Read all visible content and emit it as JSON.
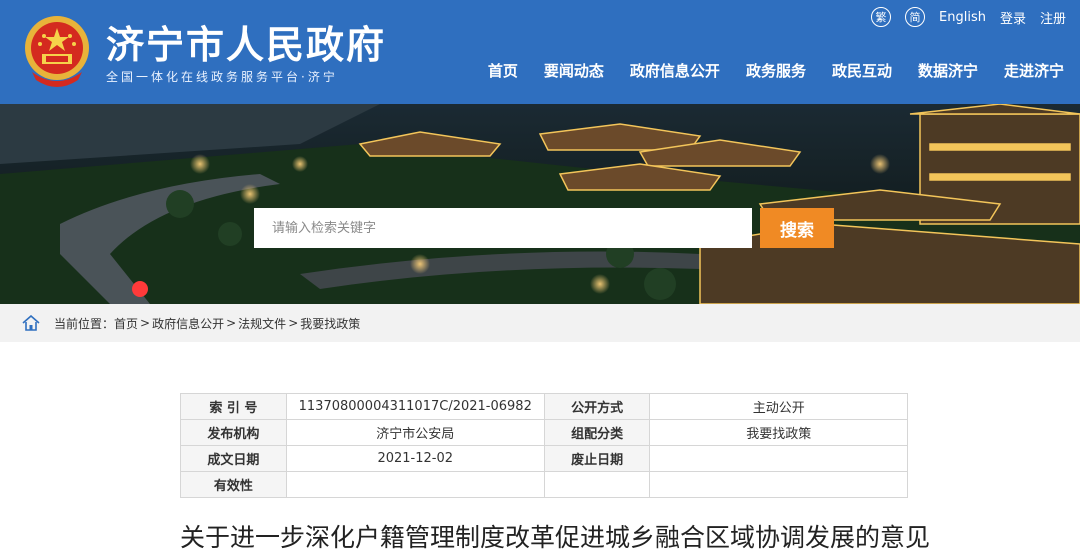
{
  "header": {
    "site_title": "济宁市人民政府",
    "site_subtitle": "全国一体化在线政务服务平台·济宁",
    "emblem_icon": "national-emblem-icon",
    "background_color": "#2f6fbf",
    "utility": {
      "traditional": "繁",
      "simplified": "简",
      "english": "English",
      "login": "登录",
      "register": "注册"
    },
    "nav": [
      {
        "label": "首页"
      },
      {
        "label": "要闻动态"
      },
      {
        "label": "政府信息公开"
      },
      {
        "label": "政务服务"
      },
      {
        "label": "政民互动"
      },
      {
        "label": "数据济宁"
      },
      {
        "label": "走进济宁"
      }
    ]
  },
  "search": {
    "placeholder": "请输入检索关键字",
    "button_label": "搜索",
    "button_color": "#f08a24"
  },
  "breadcrumb": {
    "home_icon": "home-icon",
    "prefix": "当前位置：",
    "items": [
      "首页",
      "政府信息公开",
      "法规文件",
      "我要找政策"
    ],
    "separator": ">"
  },
  "meta": {
    "rows": [
      {
        "label1": "索 引 号",
        "value1": "11370800004311017C/2021-06982",
        "label2": "公开方式",
        "value2": "主动公开"
      },
      {
        "label1": "发布机构",
        "value1": "济宁市公安局",
        "label2": "组配分类",
        "value2": "我要找政策"
      },
      {
        "label1": "成文日期",
        "value1": "2021-12-02",
        "label2": "废止日期",
        "value2": ""
      },
      {
        "label1": "有效性",
        "value1": "",
        "label2": "",
        "value2": ""
      }
    ]
  },
  "document": {
    "title": "关于进一步深化户籍管理制度改革促进城乡融合区域协调发展的意见"
  }
}
